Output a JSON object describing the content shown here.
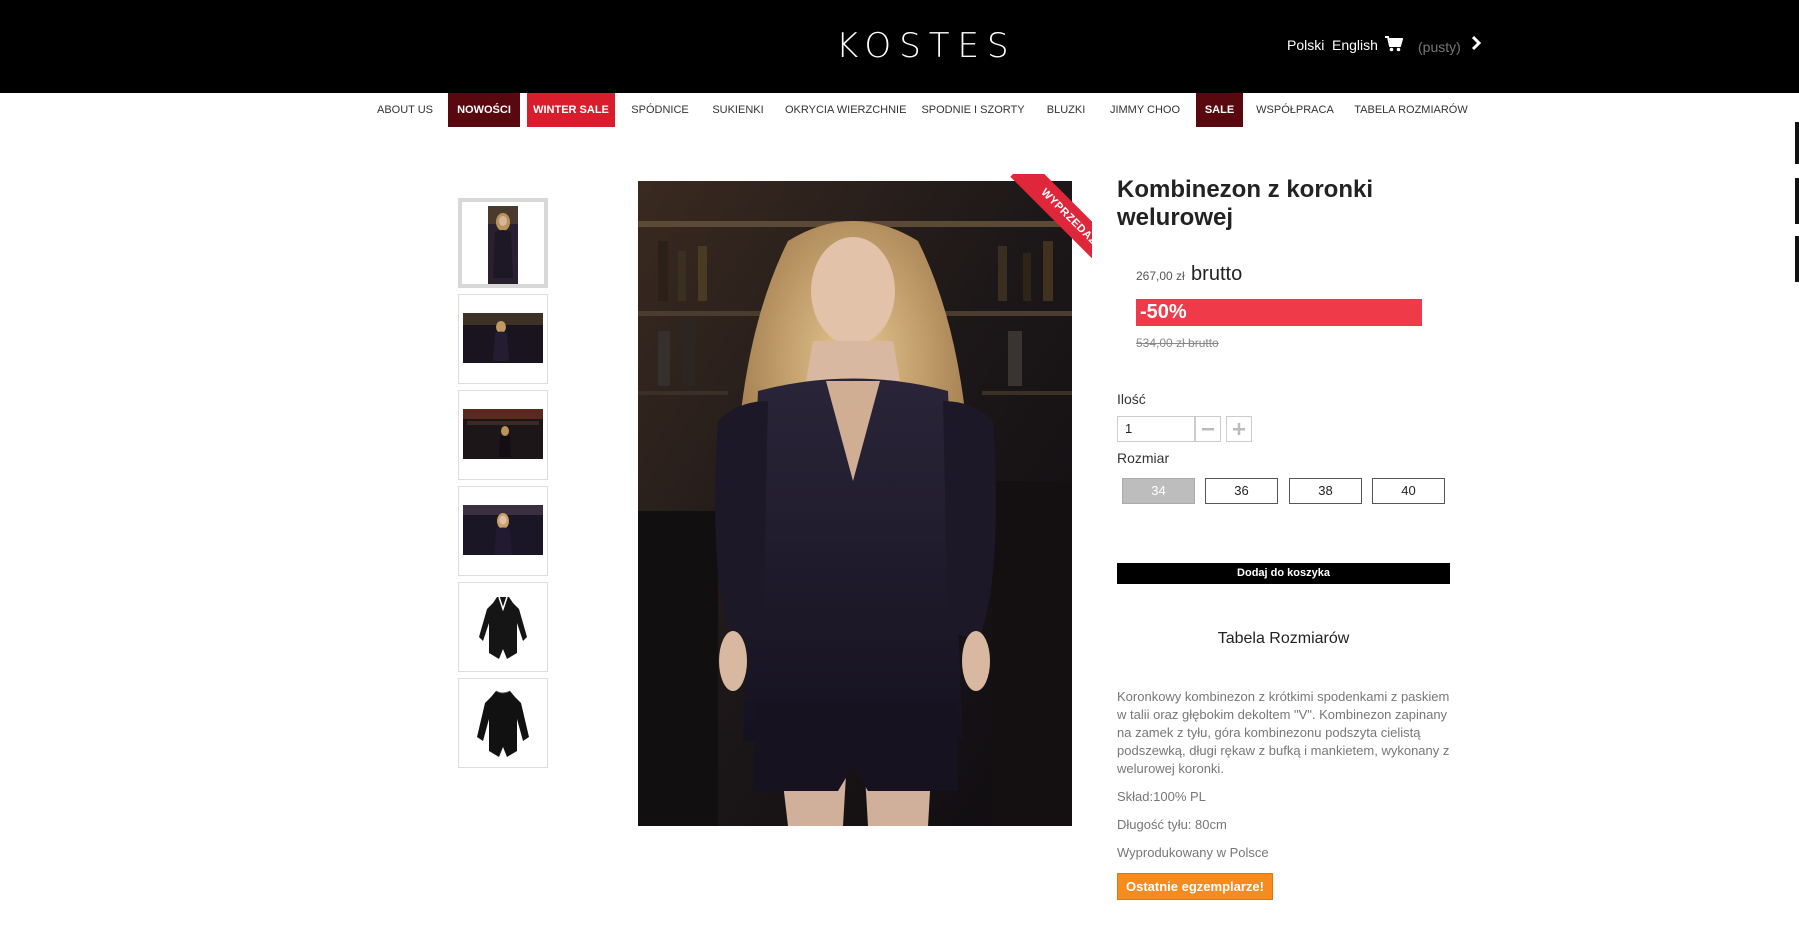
{
  "header": {
    "logo": "KOSTES",
    "languages": [
      "Polski",
      "English"
    ],
    "cart_status": "(pusty)",
    "background_color": "#000000"
  },
  "nav": {
    "items": [
      {
        "label": "ABOUT US",
        "highlight": null
      },
      {
        "label": "NOWOŚCI",
        "highlight": "#5a0810"
      },
      {
        "label": "WINTER SALE",
        "highlight": "#d81e2c"
      },
      {
        "label": "SPÓDNICE",
        "highlight": null
      },
      {
        "label": "SUKIENKI",
        "highlight": null
      },
      {
        "label": "OKRYCIA WIERZCHNIE",
        "highlight": null
      },
      {
        "label": "SPODNIE I SZORTY",
        "highlight": null
      },
      {
        "label": "BLUZKI",
        "highlight": null
      },
      {
        "label": "JIMMY CHOO",
        "highlight": null
      },
      {
        "label": "SALE",
        "highlight": "#5a0810"
      },
      {
        "label": "WSPÓŁPRACA",
        "highlight": null
      },
      {
        "label": "TABELA ROZMIARÓW",
        "highlight": null
      }
    ]
  },
  "gallery": {
    "thumbnail_count": 6,
    "active_index": 0,
    "ribbon": "WYPRZEDAŻ"
  },
  "product": {
    "title": "Kombinezon z koronki welurowej",
    "price": "267,00 zł",
    "price_suffix": "brutto",
    "discount": "-50%",
    "old_price": "534,00 zł brutto",
    "quantity_label": "Ilość",
    "quantity_value": "1",
    "size_label": "Rozmiar",
    "sizes": [
      "34",
      "36",
      "38",
      "40"
    ],
    "selected_size": "34",
    "add_to_cart": "Dodaj do koszyka",
    "size_table_link": "Tabela Rozmiarów",
    "description": "Koronkowy kombinezon z krótkimi spodenkami z paskiem w talii oraz głębokim dekoltem \"V\". Kombinezon zapinany na zamek z tyłu, góra kombinezonu podszyta cielistą podszewką, długi rękaw z bufką i mankietem, wykonany z welurowej koronki.",
    "composition": "Skład:100% PL",
    "back_length": "Długość tyłu: 80cm",
    "made_in": "Wyprodukowany w Polsce",
    "availability_badge": "Ostatnie egzemplarze!"
  },
  "colors": {
    "discount_red": "#ef3a4a",
    "ribbon_red": "#e0263a",
    "badge_orange": "#f68b1e",
    "nav_dark_red": "#5a0810",
    "nav_bright_red": "#d81e2c"
  }
}
